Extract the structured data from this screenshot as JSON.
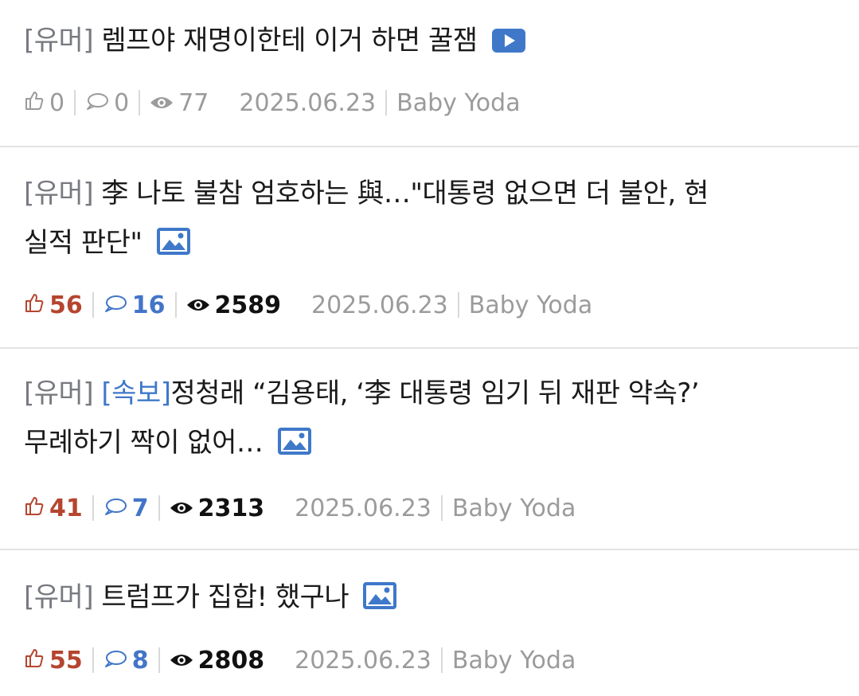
{
  "posts": [
    {
      "category": "[유머]",
      "tag": "",
      "title_lines": [
        "렘프야 재명이한테 이거 하면 꿀잼"
      ],
      "media": "video-icon",
      "likes": "0",
      "comments": "0",
      "views": "77",
      "date": "2025.06.23",
      "author": "Baby Yoda",
      "style": "gray"
    },
    {
      "category": "[유머]",
      "tag": "",
      "title_lines": [
        "李 나토 불참 엄호하는 與…\"대통령 없으면 더 불안, 현",
        "실적 판단\""
      ],
      "media": "image-icon",
      "likes": "56",
      "comments": "16",
      "views": "2589",
      "date": "2025.06.23",
      "author": "Baby Yoda",
      "style": "active"
    },
    {
      "category": "[유머]",
      "tag": "[속보]",
      "title_lines": [
        "정청래 “김용태, ‘李 대통령 임기 뒤 재판 약속?’",
        "무례하기 짝이 없어…"
      ],
      "media": "image-icon",
      "likes": "41",
      "comments": "7",
      "views": "2313",
      "date": "2025.06.23",
      "author": "Baby Yoda",
      "style": "active"
    },
    {
      "category": "[유머]",
      "tag": "",
      "title_lines": [
        "트럼프가 집합! 했구나"
      ],
      "media": "image-icon",
      "likes": "55",
      "comments": "8",
      "views": "2808",
      "date": "2025.06.23",
      "author": "Baby Yoda",
      "style": "active"
    }
  ],
  "colors": {
    "category": "#777a80",
    "tag": "#3f78c9",
    "likes_active": "#b5452f",
    "comments_active": "#4275c8",
    "views_active": "#111111",
    "inactive": "#9b9b9b"
  },
  "icons": [
    "thumbs-up-icon",
    "comment-icon",
    "eye-icon",
    "video-icon",
    "image-icon"
  ]
}
